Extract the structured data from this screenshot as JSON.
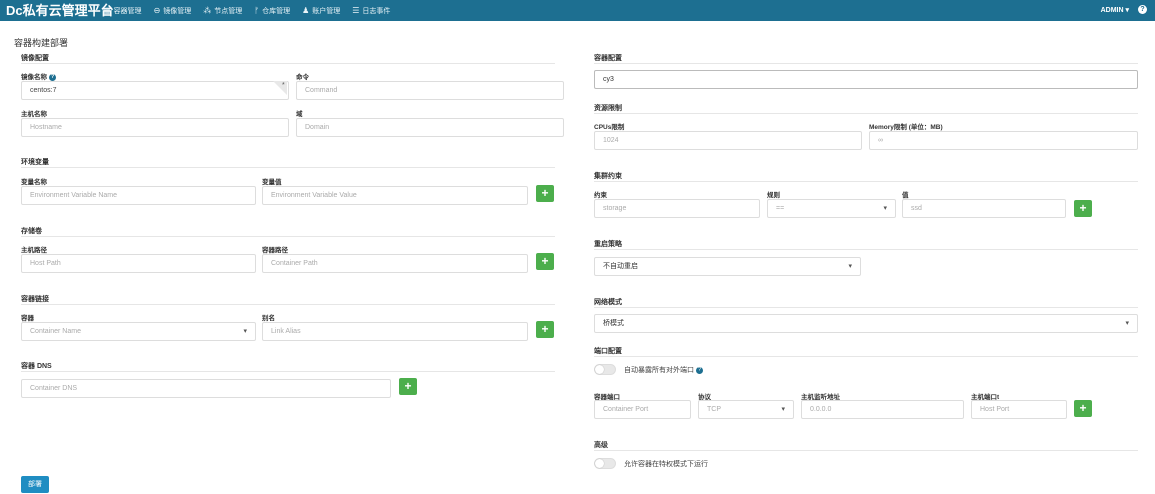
{
  "app": {
    "title": "Dc私有云管理平台",
    "user": "ADMIN",
    "help_icon": "question-icon"
  },
  "nav": [
    {
      "label": "容器管理",
      "icon": "grid-icon"
    },
    {
      "label": "镜像管理",
      "icon": "disk-icon"
    },
    {
      "label": "节点管理",
      "icon": "sitemap-icon"
    },
    {
      "label": "仓库管理",
      "icon": "code-fork-icon"
    },
    {
      "label": "账户管理",
      "icon": "user-icon"
    },
    {
      "label": "日志事件",
      "icon": "list-icon"
    }
  ],
  "page": {
    "title": "容器构建部署"
  },
  "image_cfg": {
    "section": "镜像配置",
    "image_label": "镜像名称",
    "image_value": "centos:7",
    "command_label": "命令",
    "command_placeholder": "Command",
    "hostname_label": "主机名称",
    "hostname_placeholder": "Hostname",
    "domain_label": "域",
    "domain_placeholder": "Domain"
  },
  "env": {
    "section": "环境变量",
    "name_label": "变量名称",
    "name_placeholder": "Environment Variable Name",
    "value_label": "变量值",
    "value_placeholder": "Environment Variable Value"
  },
  "volumes": {
    "section": "存储卷",
    "host_label": "主机路径",
    "host_placeholder": "Host Path",
    "container_label": "容器路径",
    "container_placeholder": "Container Path"
  },
  "links": {
    "section": "容器链接",
    "container_label": "容器",
    "container_placeholder": "Container Name",
    "alias_label": "别名",
    "alias_placeholder": "Link Alias"
  },
  "dns": {
    "section": "容器 DNS",
    "placeholder": "Container DNS"
  },
  "container_cfg": {
    "section": "容器配置",
    "name_value": "cy3"
  },
  "resources": {
    "section": "资源限制",
    "cpu_label": "CPUs限制",
    "cpu_placeholder": "1024",
    "mem_label": "Memory限制 (单位：MB)",
    "mem_placeholder": "∞"
  },
  "constraints": {
    "section": "集群约束",
    "constraint_label": "约束",
    "constraint_placeholder": "storage",
    "rule_label": "规则",
    "rule_value": "==",
    "value_label": "值",
    "value_placeholder": "ssd"
  },
  "restart": {
    "section": "重启策略",
    "value": "不自动重启"
  },
  "network": {
    "section": "网络模式",
    "value": "桥模式"
  },
  "ports": {
    "section": "端口配置",
    "auto_expose_label": "自动暴露所有对外端口",
    "container_port_label": "容器端口",
    "container_port_placeholder": "Container Port",
    "protocol_label": "协议",
    "protocol_value": "TCP",
    "host_ip_label": "主机监听地址",
    "host_ip_placeholder": "0.0.0.0",
    "host_port_label": "主机端口t",
    "host_port_placeholder": "Host Port"
  },
  "advanced": {
    "section": "高级",
    "privileged_label": "允许容器在特权模式下运行"
  },
  "deploy_label": "部署"
}
